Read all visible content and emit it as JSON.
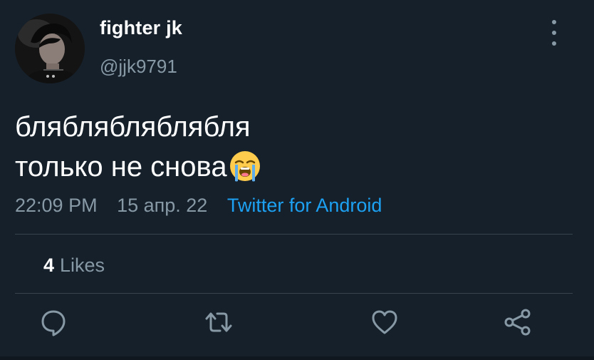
{
  "user": {
    "display_name": "fighter jk",
    "handle": "@jjk9791",
    "avatar_icon": "user-avatar-photo"
  },
  "tweet": {
    "lines": [
      "бляблябляблябля",
      "только не снова"
    ],
    "emoji": "loudly-crying-face"
  },
  "meta": {
    "time": "22:09 PM",
    "date": "15 апр. 22",
    "source": "Twitter for Android"
  },
  "stats": {
    "likes_count": "4",
    "likes_label": "Likes"
  },
  "actions": [
    {
      "name": "reply",
      "icon": "reply-icon"
    },
    {
      "name": "retweet",
      "icon": "retweet-icon"
    },
    {
      "name": "like",
      "icon": "heart-icon"
    },
    {
      "name": "share",
      "icon": "share-icon"
    }
  ],
  "colors": {
    "background": "#15202b",
    "secondary_text": "#8899a6",
    "link": "#1da1f2",
    "divider": "#38444d"
  }
}
